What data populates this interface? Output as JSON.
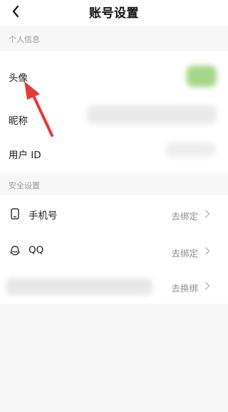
{
  "header": {
    "title": "账号设置"
  },
  "sections": {
    "personal": {
      "label": "个人信息",
      "rows": [
        {
          "label": "头像"
        },
        {
          "label": "昵称"
        },
        {
          "label": "用户 ID"
        }
      ]
    },
    "security": {
      "label": "安全设置",
      "rows": [
        {
          "label": "手机号",
          "value": "去绑定",
          "icon": "phone-icon"
        },
        {
          "label": "QQ",
          "value": "去绑定",
          "icon": "qq-icon"
        },
        {
          "label": "",
          "value": "去换绑"
        }
      ]
    }
  },
  "colors": {
    "annotation": "#e53935",
    "avatar_blur": "#9ed27a"
  }
}
